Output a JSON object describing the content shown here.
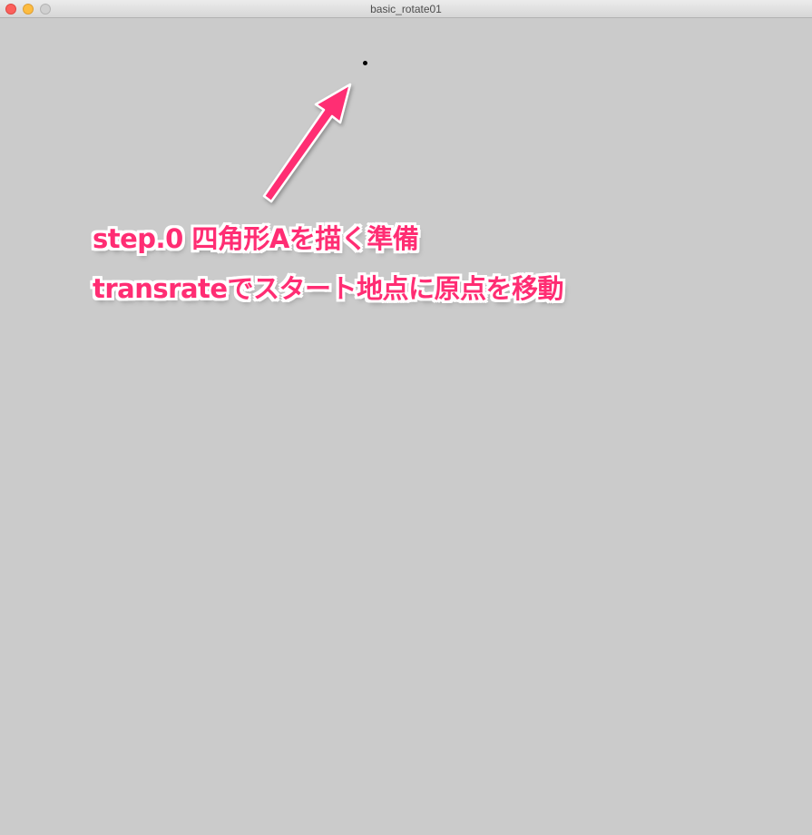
{
  "window": {
    "title": "basic_rotate01"
  },
  "canvas": {
    "background": "#cbcbcb",
    "annotation": {
      "line1": "step.0 四角形Aを描く準備",
      "line2": "transrateでスタート地点に原点を移動",
      "color": "#ff2d73",
      "arrow_icon": "arrow-up-right-icon"
    }
  }
}
